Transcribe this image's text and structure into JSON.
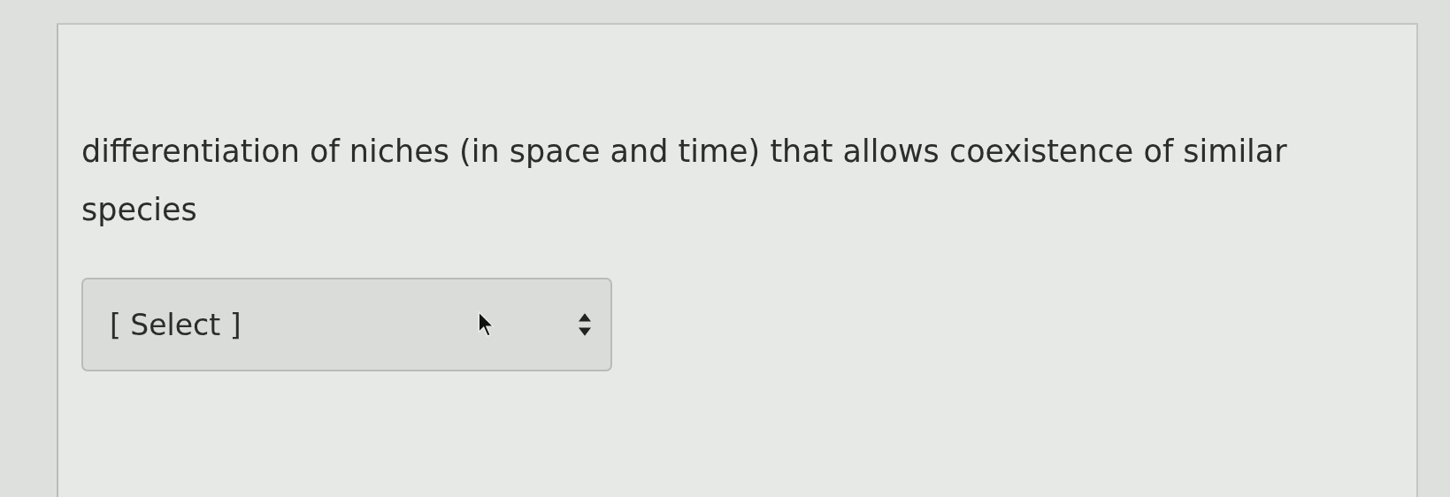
{
  "question": {
    "text": "differentiation of niches (in space and time) that allows coexistence of similar species"
  },
  "dropdown": {
    "value": "[ Select ]"
  }
}
